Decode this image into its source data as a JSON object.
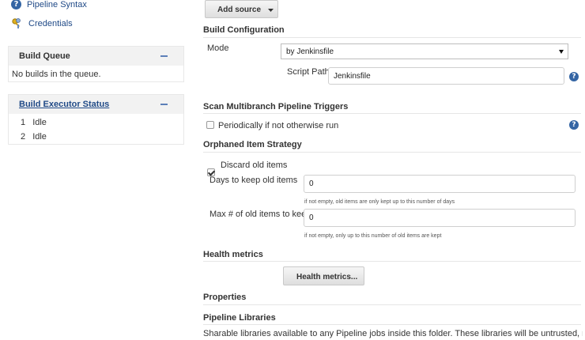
{
  "sidebar": {
    "links": [
      {
        "label": "Pipeline Syntax",
        "icon": "help-icon"
      },
      {
        "label": "Credentials",
        "icon": "credentials-keys-icon"
      }
    ],
    "build_queue": {
      "title": "Build Queue",
      "empty_text": "No builds in the queue."
    },
    "executor_status": {
      "title": "Build Executor Status",
      "executors": [
        {
          "num": "1",
          "state": "Idle"
        },
        {
          "num": "2",
          "state": "Idle"
        }
      ]
    }
  },
  "main": {
    "add_source_label": "Add source",
    "build_configuration": {
      "title": "Build Configuration",
      "mode_label": "Mode",
      "mode_value": "by Jenkinsfile",
      "script_path_label": "Script Path",
      "script_path_value": "Jenkinsfile"
    },
    "triggers": {
      "title": "Scan Multibranch Pipeline Triggers",
      "periodic_label": "Periodically if not otherwise run",
      "periodic_checked": false
    },
    "orphaned": {
      "title": "Orphaned Item Strategy",
      "discard_label": "Discard old items",
      "discard_checked": true,
      "days_label": "Days to keep old items",
      "days_value": "0",
      "days_hint": "if not empty, old items are only kept up to this number of days",
      "max_label": "Max # of old items to keep",
      "max_value": "0",
      "max_hint": "if not empty, only up to this number of old items are kept"
    },
    "health": {
      "title": "Health metrics",
      "button_label": "Health metrics..."
    },
    "properties_title": "Properties",
    "libraries": {
      "title": "Pipeline Libraries",
      "description": "Sharable libraries available to any Pipeline jobs inside this folder. These libraries will be untrusted, meaning"
    }
  },
  "colors": {
    "link": "#204a87",
    "help_icon": "#3465a4",
    "panel_header_bg": "#f2f2f2"
  }
}
